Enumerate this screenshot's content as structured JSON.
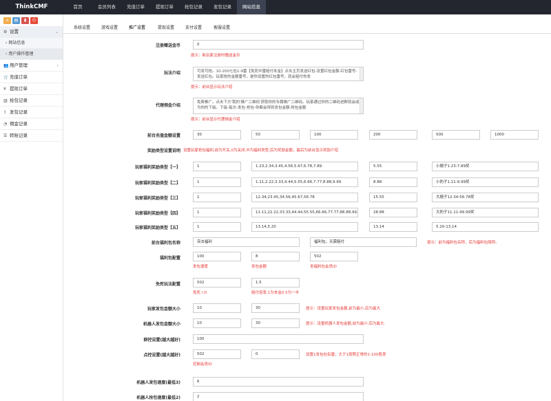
{
  "brand": "ThinkCMF",
  "topnav": [
    "首页",
    "会员列表",
    "充值订单",
    "提现订单",
    "抢包记录",
    "发包记录",
    "网站信息"
  ],
  "toolbar_colors": [
    "#f0ad4e",
    "#5b9bd5",
    "#d9534f",
    "#e74c3c"
  ],
  "sidebar": {
    "settings": "设置",
    "sub": [
      "网站信息",
      "用户操作管理"
    ],
    "items": [
      "用户管理",
      "充值订单",
      "提现订单",
      "抢包记录",
      "发包记录",
      "佣金记录",
      "转账记录"
    ]
  },
  "tabs": [
    "系统设置",
    "游戏设置",
    "推广设置",
    "提现设置",
    "支付设置",
    "客服设置"
  ],
  "form": {
    "reg_gift_label": "注册赠送金币",
    "reg_gift_value": "0",
    "reg_gift_hint": "提示：新玩家注册时赠送金币",
    "play_label": "玩法介绍",
    "play_text": "可发可抢。10-200七包1-9雷【免死中雷赔付本金】点击主页发送红包-设置红包金额-红包雷号-发送红包。玩家抢的金额雷号，是你设置的红包雷号，就会赔付你发",
    "play_hint": "提示：前台显示玩法介绍",
    "agent_label": "代理佣金介绍",
    "agent_text": "免费推广。点击下方'我的'推广二维码'获取你的专属推广二维码。玩家通过你的二维码进群就会成为你的下级。下级-每次-发包-抢包-你都会得到发包金额-抢包金额",
    "agent_hint": "提示：前台显示代理佣金介绍",
    "recharge_label": "前台充值金额设置",
    "recharge_values": [
      "30",
      "50",
      "100",
      "200",
      "500",
      "1000"
    ],
    "reward_label": "奖励类型设置说明",
    "reward_hint": "设置玩家抢包福利,前为开关,0为关闭,中为福利类型,后为奖励金额，最后为前台显示奖励介绍",
    "welfare_rows": [
      {
        "label": "玩家福利奖励类型【一】",
        "switch": "1",
        "types": "1.23,2.34,3.45,4.56,5.67,6.78,7.89",
        "amount": "5.55",
        "desc": "小顺子1.23-7.89奖"
      },
      {
        "label": "玩家福利奖励类型【二】",
        "switch": "1",
        "types": "1.11,2.22,3.33,4.44,5.55,6.66,7.77,8.88,9.99",
        "amount": "8.88",
        "desc": "小豹子1.11-9.99奖"
      },
      {
        "label": "玩家福利奖励类型【三】",
        "switch": "1",
        "types": "12.34,23.45,34.56,45.67,56.78",
        "amount": "15.55",
        "desc": "大顺子12.34-56.78奖"
      },
      {
        "label": "玩家福利奖励类型【四】",
        "switch": "1",
        "types": "11.11,22.22,33.33,44.44,55.55,66.66,77.77,88.88,99.1",
        "amount": "28.88",
        "desc": "大豹子11.11-99.99奖"
      },
      {
        "label": "玩家福利奖励类型【五】",
        "switch": "1",
        "types": "13.14,5.20",
        "amount": "13.14",
        "desc": "5.20-13.14"
      }
    ],
    "bonus_name_label": "前台福利包名称",
    "bonus_name_1": "突击福利",
    "bonus_name_2": "福利包，无需赔付",
    "bonus_name_hint": "提示：前为福利包名称，后为福利包简称。",
    "bonus_cfg_label": "福利包配置",
    "bonus_cfg_values": [
      "100",
      "8",
      "502"
    ],
    "bonus_cfg_captions": [
      "发包速度",
      "发包金额",
      "发福利包会员ID"
    ],
    "free_label": "免死玩法配置",
    "free_values": [
      "502",
      "1.5"
    ],
    "free_captions": [
      "免死 I D",
      "赔付倍率:1为本金0.5为一半"
    ],
    "player_range_label": "玩家发包金额大小",
    "player_range": [
      "10",
      "30"
    ],
    "player_range_hint": "提示：设置玩家发包金额,前为最小,后为最大",
    "robot_range_label": "机器人发包金额大小",
    "robot_range": [
      "10",
      "30"
    ],
    "robot_range_hint": "提示：设置机器人发包金额,前为最小,后为最大.",
    "group_label": "群控设置(越大越好)",
    "group_value": "100",
    "point_label": "点控设置(越大越好)",
    "point_values": [
      "502",
      "0"
    ],
    "point_hint": "设置1发包包有雷，大于1按照正常的1-100胜率",
    "point_caption": "控制会员ID",
    "robot_send_label": "机器人发包速度(最低3)",
    "robot_send_value": "6",
    "robot_grab_label": "机器人抢包速度(最低2)",
    "robot_grab_value": "2"
  }
}
